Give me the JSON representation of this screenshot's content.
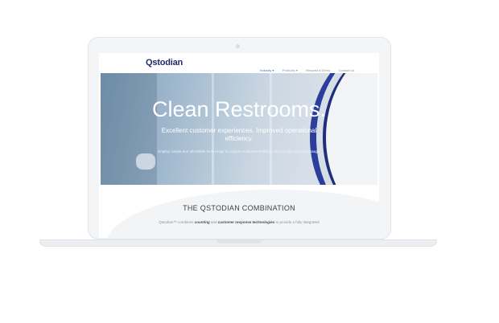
{
  "logo": {
    "text": "Qstodian"
  },
  "nav": {
    "items": [
      "Industry ▾",
      "Products ▾",
      "Request a Demo",
      "Contact Us"
    ]
  },
  "hero": {
    "title": "Clean Restrooms.",
    "subtitle": "Excellent customer experiences. Improved operational efficiency.",
    "note": "Employ simple and affordable technology to capture customer feedback and monitor restroom usage."
  },
  "section": {
    "title": "THE QSTODIAN COMBINATION",
    "text_prefix": "Qstodian™ combines",
    "text_bold1": "counting",
    "text_mid": "and",
    "text_bold2": "customer response technologies",
    "text_suffix": "to provide a fully integrated"
  },
  "colors": {
    "brand": "#1f2b6e",
    "accent": "#3b76c2",
    "swoosh": "#2b3e9c"
  }
}
